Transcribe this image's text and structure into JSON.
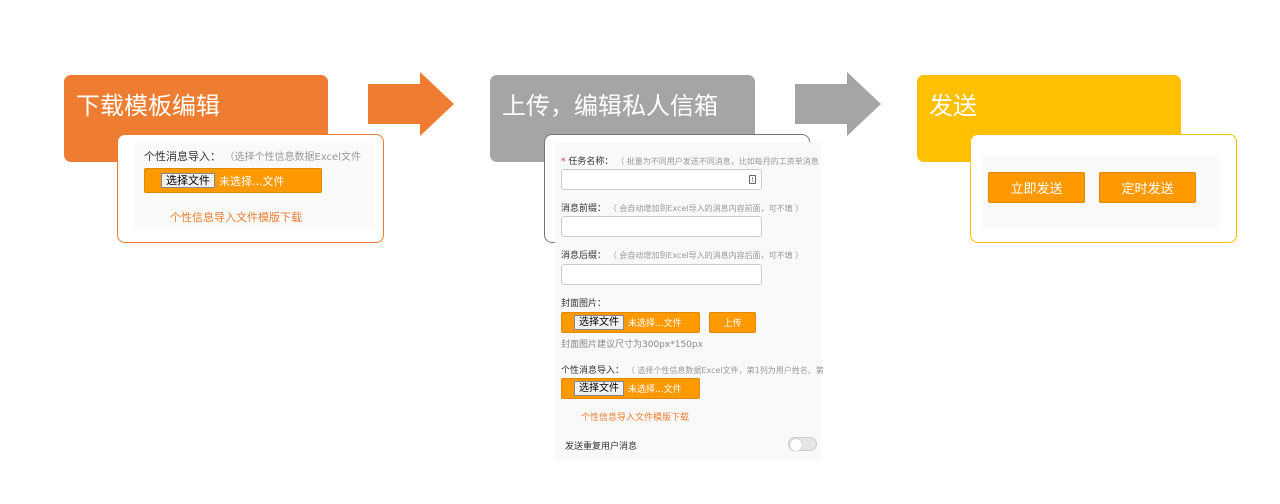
{
  "steps": [
    {
      "title": "下载模板编辑",
      "color": "#ee7d31"
    },
    {
      "title": "上传，编辑私人信箱",
      "color": "#a5a5a5"
    },
    {
      "title": "发送",
      "color": "#ffc000"
    }
  ],
  "arrows": {
    "first_color": "#ee7d31",
    "second_color": "#a5a5a5"
  },
  "card1": {
    "import_label": "个性消息导入：",
    "import_hint": "（选择个性信息数据Excel文件",
    "file_button": "选择文件",
    "file_status": "未选择...文件",
    "template_link": "个性信息导入文件模版下载"
  },
  "card2": {
    "required_mark": "*",
    "task_name_label": "任务名称：",
    "task_name_hint": "（ 批量为不同用户发送不同消息，比如每月的工资单消息",
    "prefix_label": "消息前缀：",
    "prefix_hint": "（ 会自动增加到Excel导入的消息内容前面，可不填 ）",
    "suffix_label": "消息后缀：",
    "suffix_hint": "（ 会自动增加到Excel导入的消息内容后面，可不填 ）",
    "cover_label": "封面图片：",
    "file_button": "选择文件",
    "file_status": "未选择...文件",
    "upload_button": "上传",
    "cover_size_hint": "封面图片建议尺寸为300px*150px",
    "import_label": "个性消息导入：",
    "import_hint": "（ 选择个性信息数据Excel文件，第1列为用户姓名、第",
    "template_link": "个性信息导入文件模版下载",
    "repeat_label": "发送重复用户消息",
    "repeat_enabled": false
  },
  "card3": {
    "send_now": "立即发送",
    "send_scheduled": "定时发送"
  },
  "colors": {
    "accent": "#ff9900",
    "link": "#ed7d31"
  }
}
